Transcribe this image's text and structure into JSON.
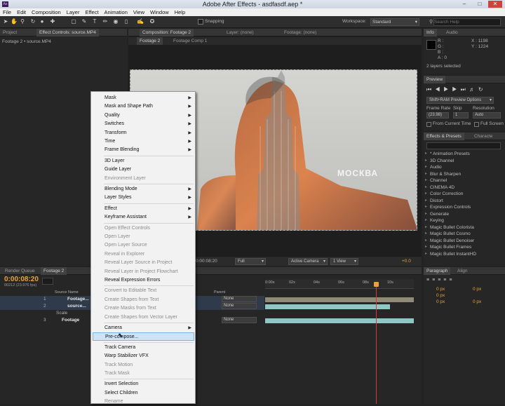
{
  "window": {
    "title": "Adobe After Effects - asdfasdf.aep *",
    "app_badge": "Ae"
  },
  "menubar": [
    "File",
    "Edit",
    "Composition",
    "Layer",
    "Effect",
    "Animation",
    "View",
    "Window",
    "Help"
  ],
  "toolbar": {
    "snapping": "Snapping",
    "workspace_label": "Workspace:",
    "workspace_value": "Standard",
    "search_help_placeholder": "Search Help"
  },
  "project_panel": {
    "tab": "Project",
    "effect_controls_tab": "Effect Controls: source.MP4",
    "breadcrumb": "Footage 2 • source.MP4"
  },
  "composition_panel": {
    "tabs": [
      "Composition: Footage 2",
      "Layer: (none)",
      "Footage: (none)"
    ],
    "subtabs": [
      "Footage 2",
      "Footage Comp 1"
    ],
    "overlay_text": "МОСКВА",
    "timecode": "0:00:08:20",
    "resolution": "Full",
    "camera": "Active Camera",
    "views": "1 View",
    "exposure": "+0.0"
  },
  "info_panel": {
    "tabs": [
      "Info",
      "Audio"
    ],
    "channels": [
      "R :",
      "G :",
      "B :",
      "A : 0"
    ],
    "x": "X : 1198",
    "y": "Y : 1224",
    "status": "2 layers selected"
  },
  "preview_panel": {
    "tab": "Preview",
    "options": "Shift+RAM Preview Options",
    "frame_rate_label": "Frame Rate",
    "skip_label": "Skip",
    "resolution_label": "Resolution",
    "frame_rate": "(23.98)",
    "skip": "1",
    "resolution": "Auto",
    "from_current": "From Current Time",
    "full_screen": "Full Screen"
  },
  "effects_panel": {
    "tabs": [
      "Effects & Presets",
      "Characte"
    ],
    "items": [
      "* Animation Presets",
      "3D Channel",
      "Audio",
      "Blur & Sharpen",
      "Channel",
      "CINEMA 4D",
      "Color Correction",
      "Distort",
      "Expression Controls",
      "Generate",
      "Keying",
      "Magic Bullet Colorista",
      "Magic Bullet Cosmo",
      "Magic Bullet Denoiser",
      "Magic Bullet Frames",
      "Magic Bullet InstantHD"
    ]
  },
  "paragraph_panel": {
    "tabs": [
      "Paragraph",
      "Align"
    ],
    "values": [
      "0 px",
      "0 px",
      "0 px",
      "0 px",
      "0 px"
    ]
  },
  "timeline": {
    "tabs": [
      "Render Queue",
      "Footage 2"
    ],
    "timecode": "0:00:08:20",
    "frame_info": "00212 (23.976 fps)",
    "column_source": "Source Name",
    "column_parent": "Parent",
    "layers": [
      {
        "num": "1",
        "name": "Footage...",
        "parent": "None"
      },
      {
        "num": "2",
        "name": "source...",
        "parent": "None"
      },
      {
        "num": "",
        "name": "Scale",
        "parent": ""
      },
      {
        "num": "3",
        "name": "Footage",
        "parent": "None"
      }
    ],
    "ruler": [
      "0:00s",
      "02s",
      "04s",
      "06s",
      "08s",
      "10s"
    ]
  },
  "context_menu": {
    "items": [
      {
        "label": "Mask",
        "sub": true,
        "disabled": false
      },
      {
        "label": "Mask and Shape Path",
        "sub": true,
        "disabled": false
      },
      {
        "label": "Quality",
        "sub": true,
        "disabled": false
      },
      {
        "label": "Switches",
        "sub": true,
        "disabled": false
      },
      {
        "label": "Transform",
        "sub": true,
        "disabled": false
      },
      {
        "label": "Time",
        "sub": true,
        "disabled": false
      },
      {
        "label": "Frame Blending",
        "sub": true,
        "disabled": false
      },
      {
        "label": "3D Layer",
        "sub": false,
        "disabled": false
      },
      {
        "label": "Guide Layer",
        "sub": false,
        "disabled": false
      },
      {
        "label": "Environment Layer",
        "sub": false,
        "disabled": true
      },
      {
        "label": "Blending Mode",
        "sub": true,
        "disabled": false
      },
      {
        "label": "Layer Styles",
        "sub": true,
        "disabled": false
      },
      {
        "label": "Effect",
        "sub": true,
        "disabled": false
      },
      {
        "label": "Keyframe Assistant",
        "sub": true,
        "disabled": false
      },
      {
        "label": "Open Effect Controls",
        "sub": false,
        "disabled": true
      },
      {
        "label": "Open Layer",
        "sub": false,
        "disabled": true
      },
      {
        "label": "Open Layer Source",
        "sub": false,
        "disabled": true
      },
      {
        "label": "Reveal in Explorer",
        "sub": false,
        "disabled": true
      },
      {
        "label": "Reveal Layer Source in Project",
        "sub": false,
        "disabled": true
      },
      {
        "label": "Reveal Layer in Project Flowchart",
        "sub": false,
        "disabled": true
      },
      {
        "label": "Reveal Expression Errors",
        "sub": false,
        "disabled": false
      },
      {
        "label": "Convert to Editable Text",
        "sub": false,
        "disabled": true
      },
      {
        "label": "Create Shapes from Text",
        "sub": false,
        "disabled": true
      },
      {
        "label": "Create Masks from Text",
        "sub": false,
        "disabled": true
      },
      {
        "label": "Create Shapes from Vector Layer",
        "sub": false,
        "disabled": true
      },
      {
        "label": "Camera",
        "sub": true,
        "disabled": false
      },
      {
        "label": "Pre-compose...",
        "sub": false,
        "disabled": false,
        "highlighted": true
      },
      {
        "label": "Track Camera",
        "sub": false,
        "disabled": false
      },
      {
        "label": "Warp Stabilizer VFX",
        "sub": false,
        "disabled": false
      },
      {
        "label": "Track Motion",
        "sub": false,
        "disabled": true
      },
      {
        "label": "Track Mask",
        "sub": false,
        "disabled": true
      },
      {
        "label": "Invert Selection",
        "sub": false,
        "disabled": false
      },
      {
        "label": "Select Children",
        "sub": false,
        "disabled": false
      },
      {
        "label": "Rename",
        "sub": false,
        "disabled": true
      }
    ]
  },
  "colors": {
    "accent_timecode": "#e8a33a",
    "playhead": "#e0303a",
    "highlight": "#cfe3f7"
  }
}
